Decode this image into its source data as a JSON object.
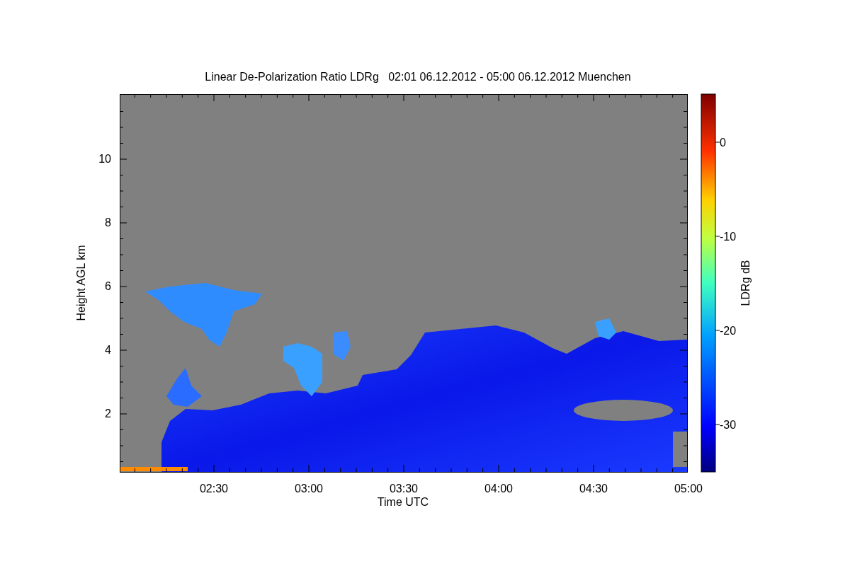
{
  "title": "Linear De-Polarization Ratio LDRg   02:01 06.12.2012 - 05:00 06.12.2012 Muenchen",
  "plot": {
    "xlabel": "Time UTC",
    "ylabel": "Height AGL km",
    "xticks": [
      "02:30",
      "03:00",
      "03:30",
      "04:00",
      "04:30",
      "05:00"
    ],
    "yticks": [
      "10",
      "8",
      "6",
      "4",
      "2"
    ]
  },
  "colorbar": {
    "label": "LDRg dB",
    "ticks": [
      "0",
      "-10",
      "-20",
      "-30"
    ]
  }
}
